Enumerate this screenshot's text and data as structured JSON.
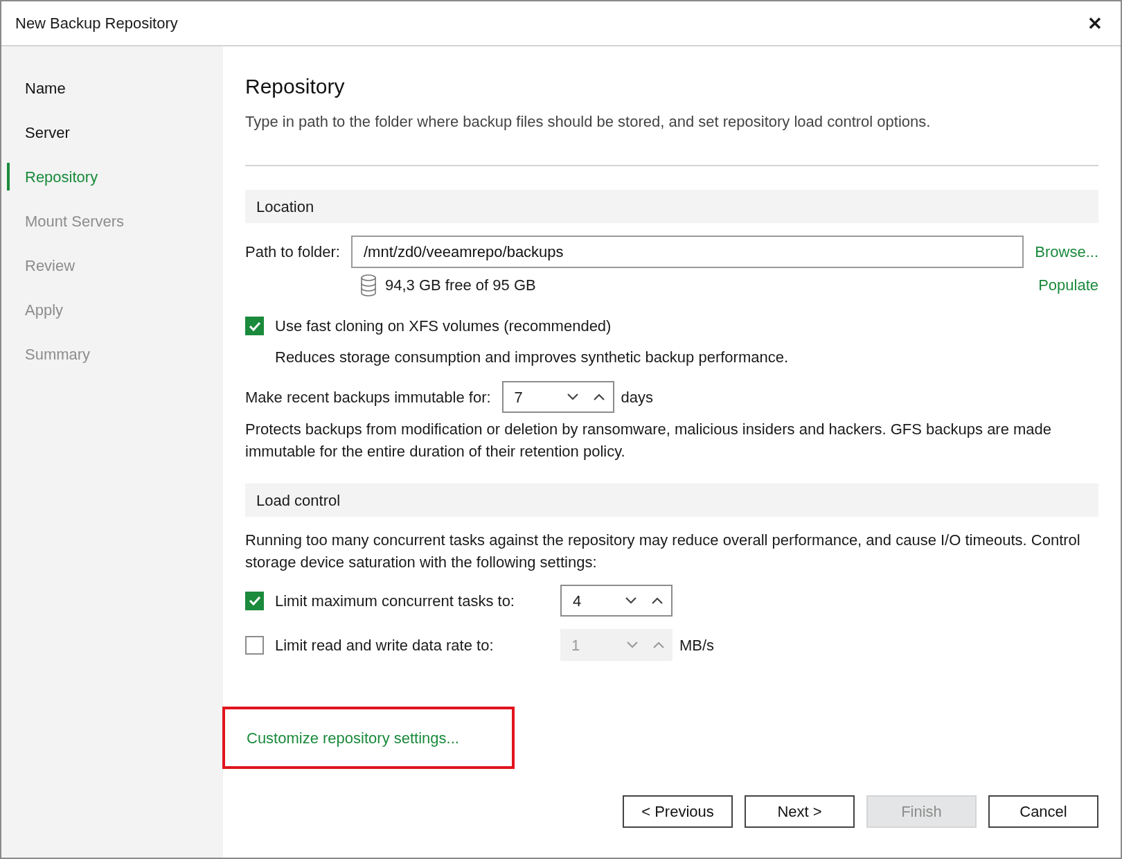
{
  "window": {
    "title": "New Backup Repository",
    "close": "✕"
  },
  "steps": [
    {
      "label": "Name",
      "selected": false,
      "disabled": false
    },
    {
      "label": "Server",
      "selected": false,
      "disabled": false
    },
    {
      "label": "Repository",
      "selected": true,
      "disabled": false
    },
    {
      "label": "Mount Servers",
      "selected": false,
      "disabled": true
    },
    {
      "label": "Review",
      "selected": false,
      "disabled": true
    },
    {
      "label": "Apply",
      "selected": false,
      "disabled": true
    },
    {
      "label": "Summary",
      "selected": false,
      "disabled": true
    }
  ],
  "heading": "Repository",
  "description": "Type in path to the folder where backup files should be stored, and set repository load control options.",
  "location": {
    "title": "Location",
    "path_label": "Path to folder:",
    "path_value": "/mnt/zd0/veeamrepo/backups",
    "browse": "Browse...",
    "populate": "Populate",
    "free_space": "94,3 GB free of 95 GB",
    "fast_clone": {
      "label": "Use fast cloning on XFS volumes (recommended)",
      "checked": true,
      "note": "Reduces storage consumption and improves synthetic backup performance."
    },
    "immutable": {
      "label": "Make recent backups immutable for:",
      "value": "7",
      "unit": "days",
      "disabled": false
    },
    "immutable_note": "Protects backups from modification or deletion by ransomware, malicious insiders and hackers. GFS backups are made immutable for the entire duration of their retention policy."
  },
  "load_control": {
    "title": "Load control",
    "note": "Running too many concurrent tasks against the repository may reduce overall performance, and cause I/O timeouts. Control storage device saturation with the following settings:",
    "options": [
      {
        "label": "Limit maximum concurrent tasks to:",
        "checked": true,
        "value": "4",
        "disabled": false
      },
      {
        "label": "Limit read and write data rate to:",
        "checked": false,
        "value": "1",
        "unit": "MB/s",
        "disabled": true
      }
    ]
  },
  "customize_link": {
    "label": "Customize repository settings...",
    "highlighted": true
  },
  "buttons": [
    {
      "label": "< Previous",
      "disabled": false
    },
    {
      "label": "Next >",
      "disabled": false
    },
    {
      "label": "Finish",
      "disabled": true
    },
    {
      "label": "Cancel",
      "disabled": false
    }
  ]
}
